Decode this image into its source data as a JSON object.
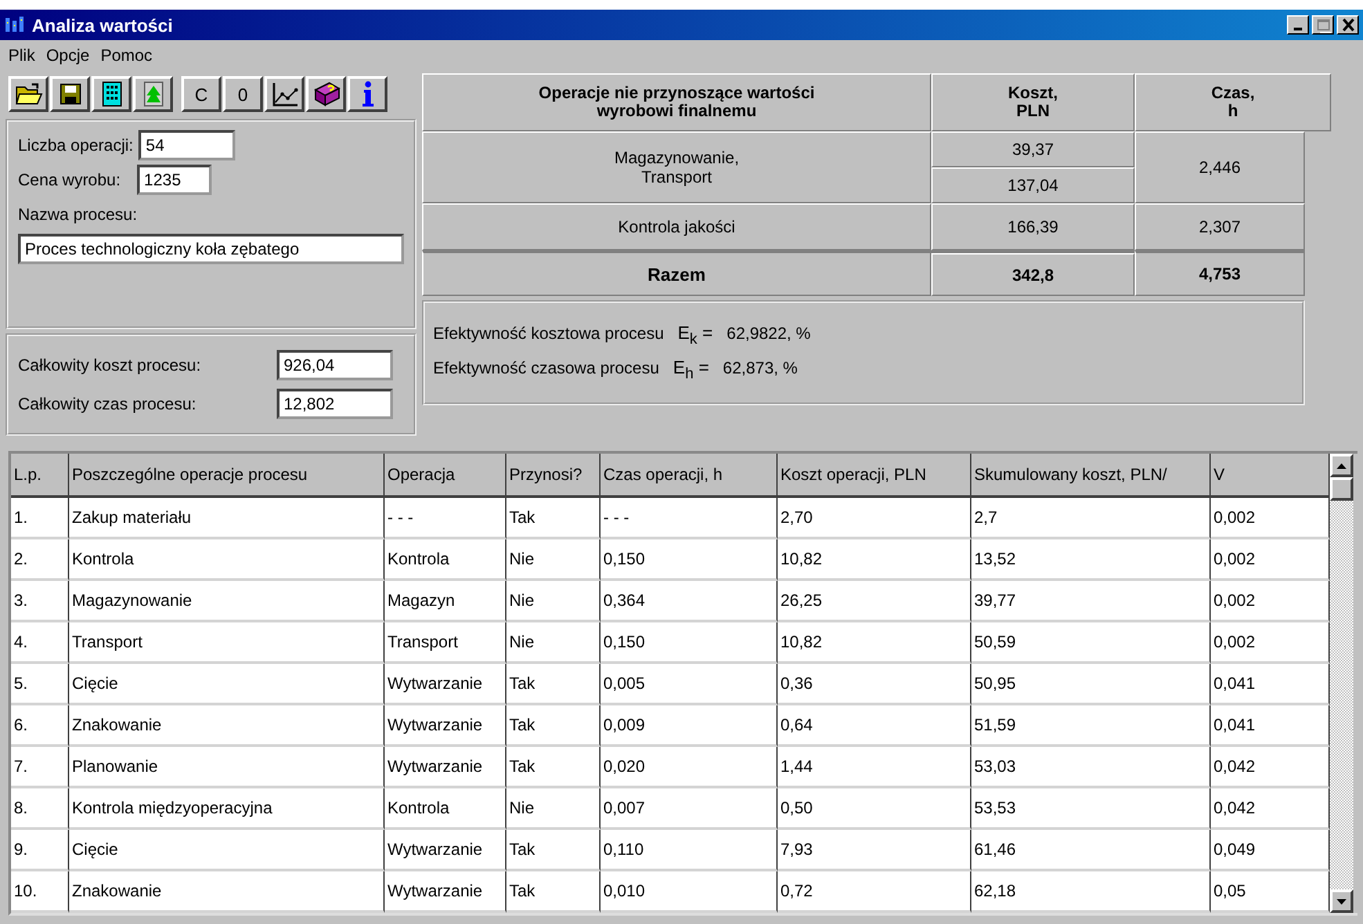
{
  "window": {
    "title": "Analiza wartości",
    "controls": [
      {
        "kind": "minimize",
        "disabled": false
      },
      {
        "kind": "maximize",
        "disabled": true
      },
      {
        "kind": "close",
        "disabled": false
      }
    ]
  },
  "menu": [
    {
      "label": "Plik"
    },
    {
      "label": "Opcje"
    },
    {
      "label": "Pomoc"
    }
  ],
  "toolbar": {
    "groups": [
      [
        {
          "kind": "open"
        },
        {
          "kind": "save"
        },
        {
          "kind": "calculator"
        },
        {
          "kind": "tree"
        }
      ],
      [
        {
          "kind": "text",
          "label": "C"
        },
        {
          "kind": "text",
          "label": "0"
        },
        {
          "kind": "chart"
        },
        {
          "kind": "help"
        },
        {
          "kind": "info"
        }
      ]
    ]
  },
  "parameters": {
    "fields": [
      {
        "label": "Liczba operacji:",
        "value": "54"
      },
      {
        "label": "Cena wyrobu:",
        "value": "1235"
      }
    ],
    "name_label": "Nazwa procesu:",
    "name_value": "Proces technologiczny koła zębatego"
  },
  "totals": [
    {
      "label": "Całkowity koszt procesu:",
      "value": "926,04"
    },
    {
      "label": "Całkowity czas procesu:",
      "value": "12,802"
    }
  ],
  "summary": {
    "headers": [
      "Operacje nie przynoszące wartości wyrobowi finalnemu",
      "Koszt, PLN",
      "Czas, h"
    ],
    "rows": [
      {
        "kind": "split",
        "label": "Magazynowanie,\nTransport",
        "costs": [
          "39,37",
          "137,04"
        ],
        "time": "2,446"
      },
      {
        "kind": "plain",
        "label": "Kontrola jakości",
        "costs": [
          "166,39"
        ],
        "time": "2,307"
      },
      {
        "kind": "total",
        "label": "Razem",
        "costs": [
          "342,8"
        ],
        "time": "4,753"
      }
    ]
  },
  "efficiency": [
    {
      "label": "Efektywność kosztowa procesu",
      "formula": "E$_{k}$ =",
      "value": "62,9822, %"
    },
    {
      "label": "Efektywność czasowa procesu",
      "formula": "E$_{h}$ =",
      "value": "62,873, %"
    }
  ],
  "table": {
    "columns": [
      "L.p.",
      "Poszczególne operacje procesu",
      "Operacja",
      "Przynosi?",
      "Czas operacji, h",
      "Koszt operacji, PLN",
      "Skumulowany koszt, PLN/",
      "V"
    ],
    "rows": [
      [
        "1.",
        "Zakup materiału",
        "- - -",
        "Tak",
        "- - -",
        "2,70",
        "2,7",
        "0,002"
      ],
      [
        "2.",
        "Kontrola",
        "Kontrola",
        "Nie",
        "0,150",
        "10,82",
        "13,52",
        "0,002"
      ],
      [
        "3.",
        "Magazynowanie",
        "Magazyn",
        "Nie",
        "0,364",
        "26,25",
        "39,77",
        "0,002"
      ],
      [
        "4.",
        "Transport",
        "Transport",
        "Nie",
        "0,150",
        "10,82",
        "50,59",
        "0,002"
      ],
      [
        "5.",
        "Cięcie",
        "Wytwarzanie",
        "Tak",
        "0,005",
        "0,36",
        "50,95",
        "0,041"
      ],
      [
        "6.",
        "Znakowanie",
        "Wytwarzanie",
        "Tak",
        "0,009",
        "0,64",
        "51,59",
        "0,041"
      ],
      [
        "7.",
        "Planowanie",
        "Wytwarzanie",
        "Tak",
        "0,020",
        "1,44",
        "53,03",
        "0,042"
      ],
      [
        "8.",
        "Kontrola międzyoperacyjna",
        "Kontrola",
        "Nie",
        "0,007",
        "0,50",
        "53,53",
        "0,042"
      ],
      [
        "9.",
        "Cięcie",
        "Wytwarzanie",
        "Tak",
        "0,110",
        "7,93",
        "61,46",
        "0,049"
      ],
      [
        "10.",
        "Znakowanie",
        "Wytwarzanie",
        "Tak",
        "0,010",
        "0,72",
        "62,18",
        "0,05"
      ]
    ]
  }
}
